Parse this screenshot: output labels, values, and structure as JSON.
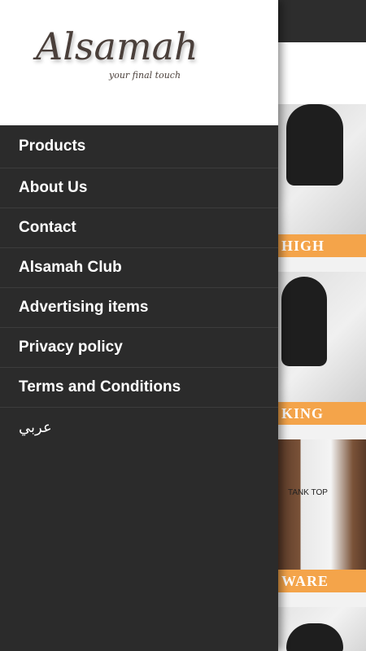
{
  "app": {
    "logo_text": "Alsamah",
    "logo_tagline": "your final touch"
  },
  "menu": {
    "items": [
      {
        "label": "Products"
      },
      {
        "label": "About Us"
      },
      {
        "label": "Contact"
      },
      {
        "label": "Alsamah Club"
      },
      {
        "label": "Advertising items"
      },
      {
        "label": "Privacy policy"
      },
      {
        "label": "Terms and Conditions"
      },
      {
        "label": "عربي"
      }
    ]
  },
  "background": {
    "cards": [
      {
        "banner": "HIGH"
      },
      {
        "banner": "KING"
      },
      {
        "banner": "WARE",
        "photo_label": "TANK TOP"
      },
      {
        "banner": ""
      }
    ]
  },
  "colors": {
    "drawer_bg": "#2b2b2b",
    "banner": "#f4a44a",
    "text": "#ffffff"
  }
}
